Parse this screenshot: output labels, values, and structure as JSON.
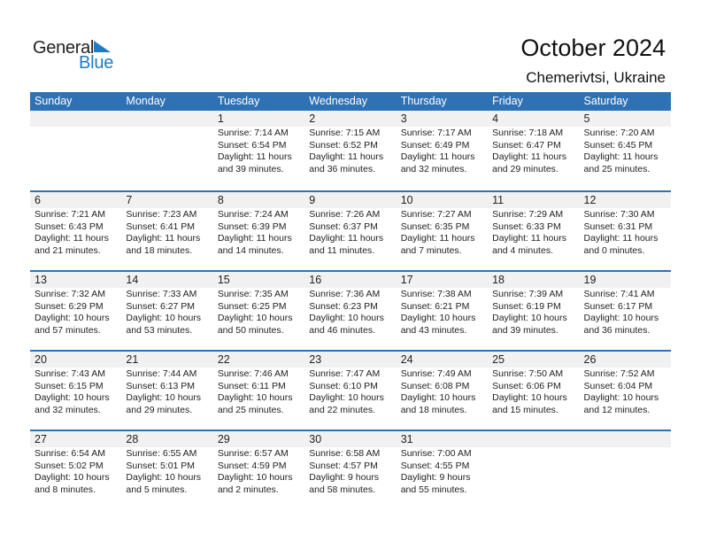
{
  "logo": {
    "word1": "General",
    "word2": "Blue",
    "accent_color": "#1f7bc4"
  },
  "header": {
    "title": "October 2024",
    "location": "Chemerivtsi, Ukraine"
  },
  "colors": {
    "header_bg": "#2e72b5",
    "header_text": "#ffffff",
    "daynum_bg": "#f1f1f1"
  },
  "weekdays": [
    "Sunday",
    "Monday",
    "Tuesday",
    "Wednesday",
    "Thursday",
    "Friday",
    "Saturday"
  ],
  "weeks": [
    [
      null,
      null,
      {
        "day": "1",
        "sunrise": "Sunrise: 7:14 AM",
        "sunset": "Sunset: 6:54 PM",
        "daylight1": "Daylight: 11 hours",
        "daylight2": "and 39 minutes."
      },
      {
        "day": "2",
        "sunrise": "Sunrise: 7:15 AM",
        "sunset": "Sunset: 6:52 PM",
        "daylight1": "Daylight: 11 hours",
        "daylight2": "and 36 minutes."
      },
      {
        "day": "3",
        "sunrise": "Sunrise: 7:17 AM",
        "sunset": "Sunset: 6:49 PM",
        "daylight1": "Daylight: 11 hours",
        "daylight2": "and 32 minutes."
      },
      {
        "day": "4",
        "sunrise": "Sunrise: 7:18 AM",
        "sunset": "Sunset: 6:47 PM",
        "daylight1": "Daylight: 11 hours",
        "daylight2": "and 29 minutes."
      },
      {
        "day": "5",
        "sunrise": "Sunrise: 7:20 AM",
        "sunset": "Sunset: 6:45 PM",
        "daylight1": "Daylight: 11 hours",
        "daylight2": "and 25 minutes."
      }
    ],
    [
      {
        "day": "6",
        "sunrise": "Sunrise: 7:21 AM",
        "sunset": "Sunset: 6:43 PM",
        "daylight1": "Daylight: 11 hours",
        "daylight2": "and 21 minutes."
      },
      {
        "day": "7",
        "sunrise": "Sunrise: 7:23 AM",
        "sunset": "Sunset: 6:41 PM",
        "daylight1": "Daylight: 11 hours",
        "daylight2": "and 18 minutes."
      },
      {
        "day": "8",
        "sunrise": "Sunrise: 7:24 AM",
        "sunset": "Sunset: 6:39 PM",
        "daylight1": "Daylight: 11 hours",
        "daylight2": "and 14 minutes."
      },
      {
        "day": "9",
        "sunrise": "Sunrise: 7:26 AM",
        "sunset": "Sunset: 6:37 PM",
        "daylight1": "Daylight: 11 hours",
        "daylight2": "and 11 minutes."
      },
      {
        "day": "10",
        "sunrise": "Sunrise: 7:27 AM",
        "sunset": "Sunset: 6:35 PM",
        "daylight1": "Daylight: 11 hours",
        "daylight2": "and 7 minutes."
      },
      {
        "day": "11",
        "sunrise": "Sunrise: 7:29 AM",
        "sunset": "Sunset: 6:33 PM",
        "daylight1": "Daylight: 11 hours",
        "daylight2": "and 4 minutes."
      },
      {
        "day": "12",
        "sunrise": "Sunrise: 7:30 AM",
        "sunset": "Sunset: 6:31 PM",
        "daylight1": "Daylight: 11 hours",
        "daylight2": "and 0 minutes."
      }
    ],
    [
      {
        "day": "13",
        "sunrise": "Sunrise: 7:32 AM",
        "sunset": "Sunset: 6:29 PM",
        "daylight1": "Daylight: 10 hours",
        "daylight2": "and 57 minutes."
      },
      {
        "day": "14",
        "sunrise": "Sunrise: 7:33 AM",
        "sunset": "Sunset: 6:27 PM",
        "daylight1": "Daylight: 10 hours",
        "daylight2": "and 53 minutes."
      },
      {
        "day": "15",
        "sunrise": "Sunrise: 7:35 AM",
        "sunset": "Sunset: 6:25 PM",
        "daylight1": "Daylight: 10 hours",
        "daylight2": "and 50 minutes."
      },
      {
        "day": "16",
        "sunrise": "Sunrise: 7:36 AM",
        "sunset": "Sunset: 6:23 PM",
        "daylight1": "Daylight: 10 hours",
        "daylight2": "and 46 minutes."
      },
      {
        "day": "17",
        "sunrise": "Sunrise: 7:38 AM",
        "sunset": "Sunset: 6:21 PM",
        "daylight1": "Daylight: 10 hours",
        "daylight2": "and 43 minutes."
      },
      {
        "day": "18",
        "sunrise": "Sunrise: 7:39 AM",
        "sunset": "Sunset: 6:19 PM",
        "daylight1": "Daylight: 10 hours",
        "daylight2": "and 39 minutes."
      },
      {
        "day": "19",
        "sunrise": "Sunrise: 7:41 AM",
        "sunset": "Sunset: 6:17 PM",
        "daylight1": "Daylight: 10 hours",
        "daylight2": "and 36 minutes."
      }
    ],
    [
      {
        "day": "20",
        "sunrise": "Sunrise: 7:43 AM",
        "sunset": "Sunset: 6:15 PM",
        "daylight1": "Daylight: 10 hours",
        "daylight2": "and 32 minutes."
      },
      {
        "day": "21",
        "sunrise": "Sunrise: 7:44 AM",
        "sunset": "Sunset: 6:13 PM",
        "daylight1": "Daylight: 10 hours",
        "daylight2": "and 29 minutes."
      },
      {
        "day": "22",
        "sunrise": "Sunrise: 7:46 AM",
        "sunset": "Sunset: 6:11 PM",
        "daylight1": "Daylight: 10 hours",
        "daylight2": "and 25 minutes."
      },
      {
        "day": "23",
        "sunrise": "Sunrise: 7:47 AM",
        "sunset": "Sunset: 6:10 PM",
        "daylight1": "Daylight: 10 hours",
        "daylight2": "and 22 minutes."
      },
      {
        "day": "24",
        "sunrise": "Sunrise: 7:49 AM",
        "sunset": "Sunset: 6:08 PM",
        "daylight1": "Daylight: 10 hours",
        "daylight2": "and 18 minutes."
      },
      {
        "day": "25",
        "sunrise": "Sunrise: 7:50 AM",
        "sunset": "Sunset: 6:06 PM",
        "daylight1": "Daylight: 10 hours",
        "daylight2": "and 15 minutes."
      },
      {
        "day": "26",
        "sunrise": "Sunrise: 7:52 AM",
        "sunset": "Sunset: 6:04 PM",
        "daylight1": "Daylight: 10 hours",
        "daylight2": "and 12 minutes."
      }
    ],
    [
      {
        "day": "27",
        "sunrise": "Sunrise: 6:54 AM",
        "sunset": "Sunset: 5:02 PM",
        "daylight1": "Daylight: 10 hours",
        "daylight2": "and 8 minutes."
      },
      {
        "day": "28",
        "sunrise": "Sunrise: 6:55 AM",
        "sunset": "Sunset: 5:01 PM",
        "daylight1": "Daylight: 10 hours",
        "daylight2": "and 5 minutes."
      },
      {
        "day": "29",
        "sunrise": "Sunrise: 6:57 AM",
        "sunset": "Sunset: 4:59 PM",
        "daylight1": "Daylight: 10 hours",
        "daylight2": "and 2 minutes."
      },
      {
        "day": "30",
        "sunrise": "Sunrise: 6:58 AM",
        "sunset": "Sunset: 4:57 PM",
        "daylight1": "Daylight: 9 hours",
        "daylight2": "and 58 minutes."
      },
      {
        "day": "31",
        "sunrise": "Sunrise: 7:00 AM",
        "sunset": "Sunset: 4:55 PM",
        "daylight1": "Daylight: 9 hours",
        "daylight2": "and 55 minutes."
      },
      null,
      null
    ]
  ]
}
